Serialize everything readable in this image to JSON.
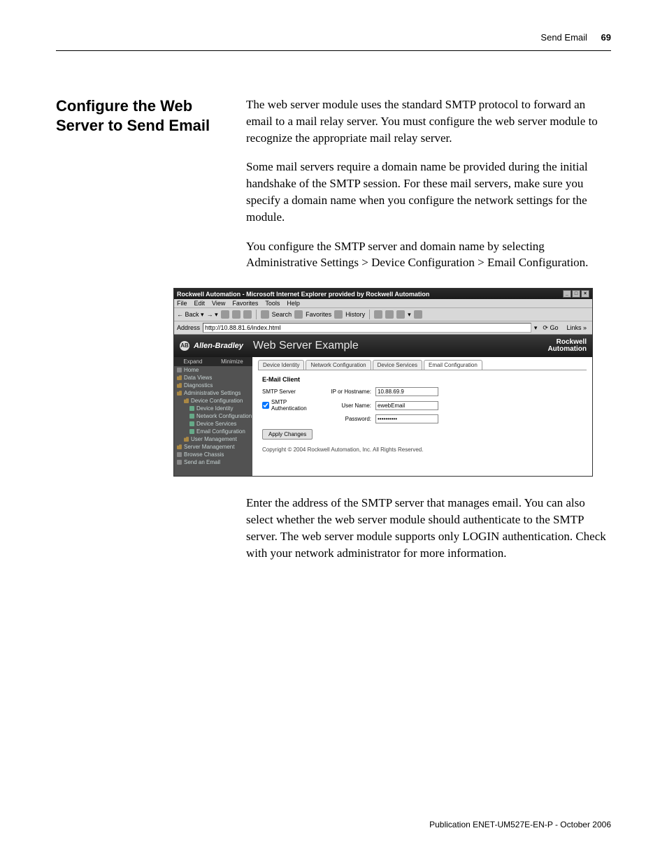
{
  "header": {
    "section": "Send Email",
    "page_number": "69"
  },
  "heading": "Configure the Web Server to Send Email",
  "paragraphs": {
    "p1": "The web server module uses the standard SMTP protocol to forward an email to a mail relay server. You must configure the web server module to recognize the appropriate mail relay server.",
    "p2": "Some mail servers require a domain name be provided during the initial handshake of the SMTP session. For these mail servers, make sure you specify a domain name when you configure the network settings for the module.",
    "p3": "You configure the SMTP server and domain name by selecting Administrative Settings > Device Configuration > Email Configuration.",
    "p4": "Enter the address of the SMTP server that manages email. You can also select whether the web server module should authenticate to the SMTP server. The web server module supports only LOGIN authentication. Check with your network administrator for more information."
  },
  "ie": {
    "title": "Rockwell Automation - Microsoft Internet Explorer provided by Rockwell Automation",
    "menus": [
      "File",
      "Edit",
      "View",
      "Favorites",
      "Tools",
      "Help"
    ],
    "toolbar": {
      "back": "Back",
      "search": "Search",
      "favorites": "Favorites",
      "history": "History"
    },
    "address_label": "Address",
    "address_value": "http://10.88.81.6/index.html",
    "go": "Go",
    "links": "Links"
  },
  "app": {
    "brand_logo": "AB",
    "brand_name": "Allen-Bradley",
    "title": "Web Server Example",
    "ra_line1": "Rockwell",
    "ra_line2": "Automation"
  },
  "sidebar": {
    "expand": "Expand",
    "minimize": "Minimize",
    "items": [
      {
        "label": "Home",
        "cls": ""
      },
      {
        "label": "Data Views",
        "cls": "folder"
      },
      {
        "label": "Diagnostics",
        "cls": "folder"
      },
      {
        "label": "Administrative Settings",
        "cls": "folder"
      },
      {
        "label": "Device Configuration",
        "cls": "folder nested"
      },
      {
        "label": "Device Identity",
        "cls": "nested2"
      },
      {
        "label": "Network Configuration",
        "cls": "nested2"
      },
      {
        "label": "Device Services",
        "cls": "nested2"
      },
      {
        "label": "Email Configuration",
        "cls": "nested2"
      },
      {
        "label": "User Management",
        "cls": "folder nested"
      },
      {
        "label": "Server Management",
        "cls": "folder"
      },
      {
        "label": "Browse Chassis",
        "cls": ""
      },
      {
        "label": "Send an Email",
        "cls": ""
      }
    ]
  },
  "tabs": [
    "Device Identity",
    "Network Configuration",
    "Device Services",
    "Email Configuration"
  ],
  "form": {
    "title": "E-Mail Client",
    "smtp_server_label": "SMTP Server",
    "ip_label": "IP or Hostname:",
    "ip_value": "10.88.69.9",
    "auth_label": "SMTP Authentication",
    "user_label": "User Name:",
    "user_value": "ewebEmail",
    "pass_label": "Password:",
    "pass_value": "**********",
    "apply": "Apply Changes"
  },
  "copyright": "Copyright © 2004 Rockwell Automation, Inc. All Rights Reserved.",
  "footer": "Publication ENET-UM527E-EN-P - October 2006"
}
